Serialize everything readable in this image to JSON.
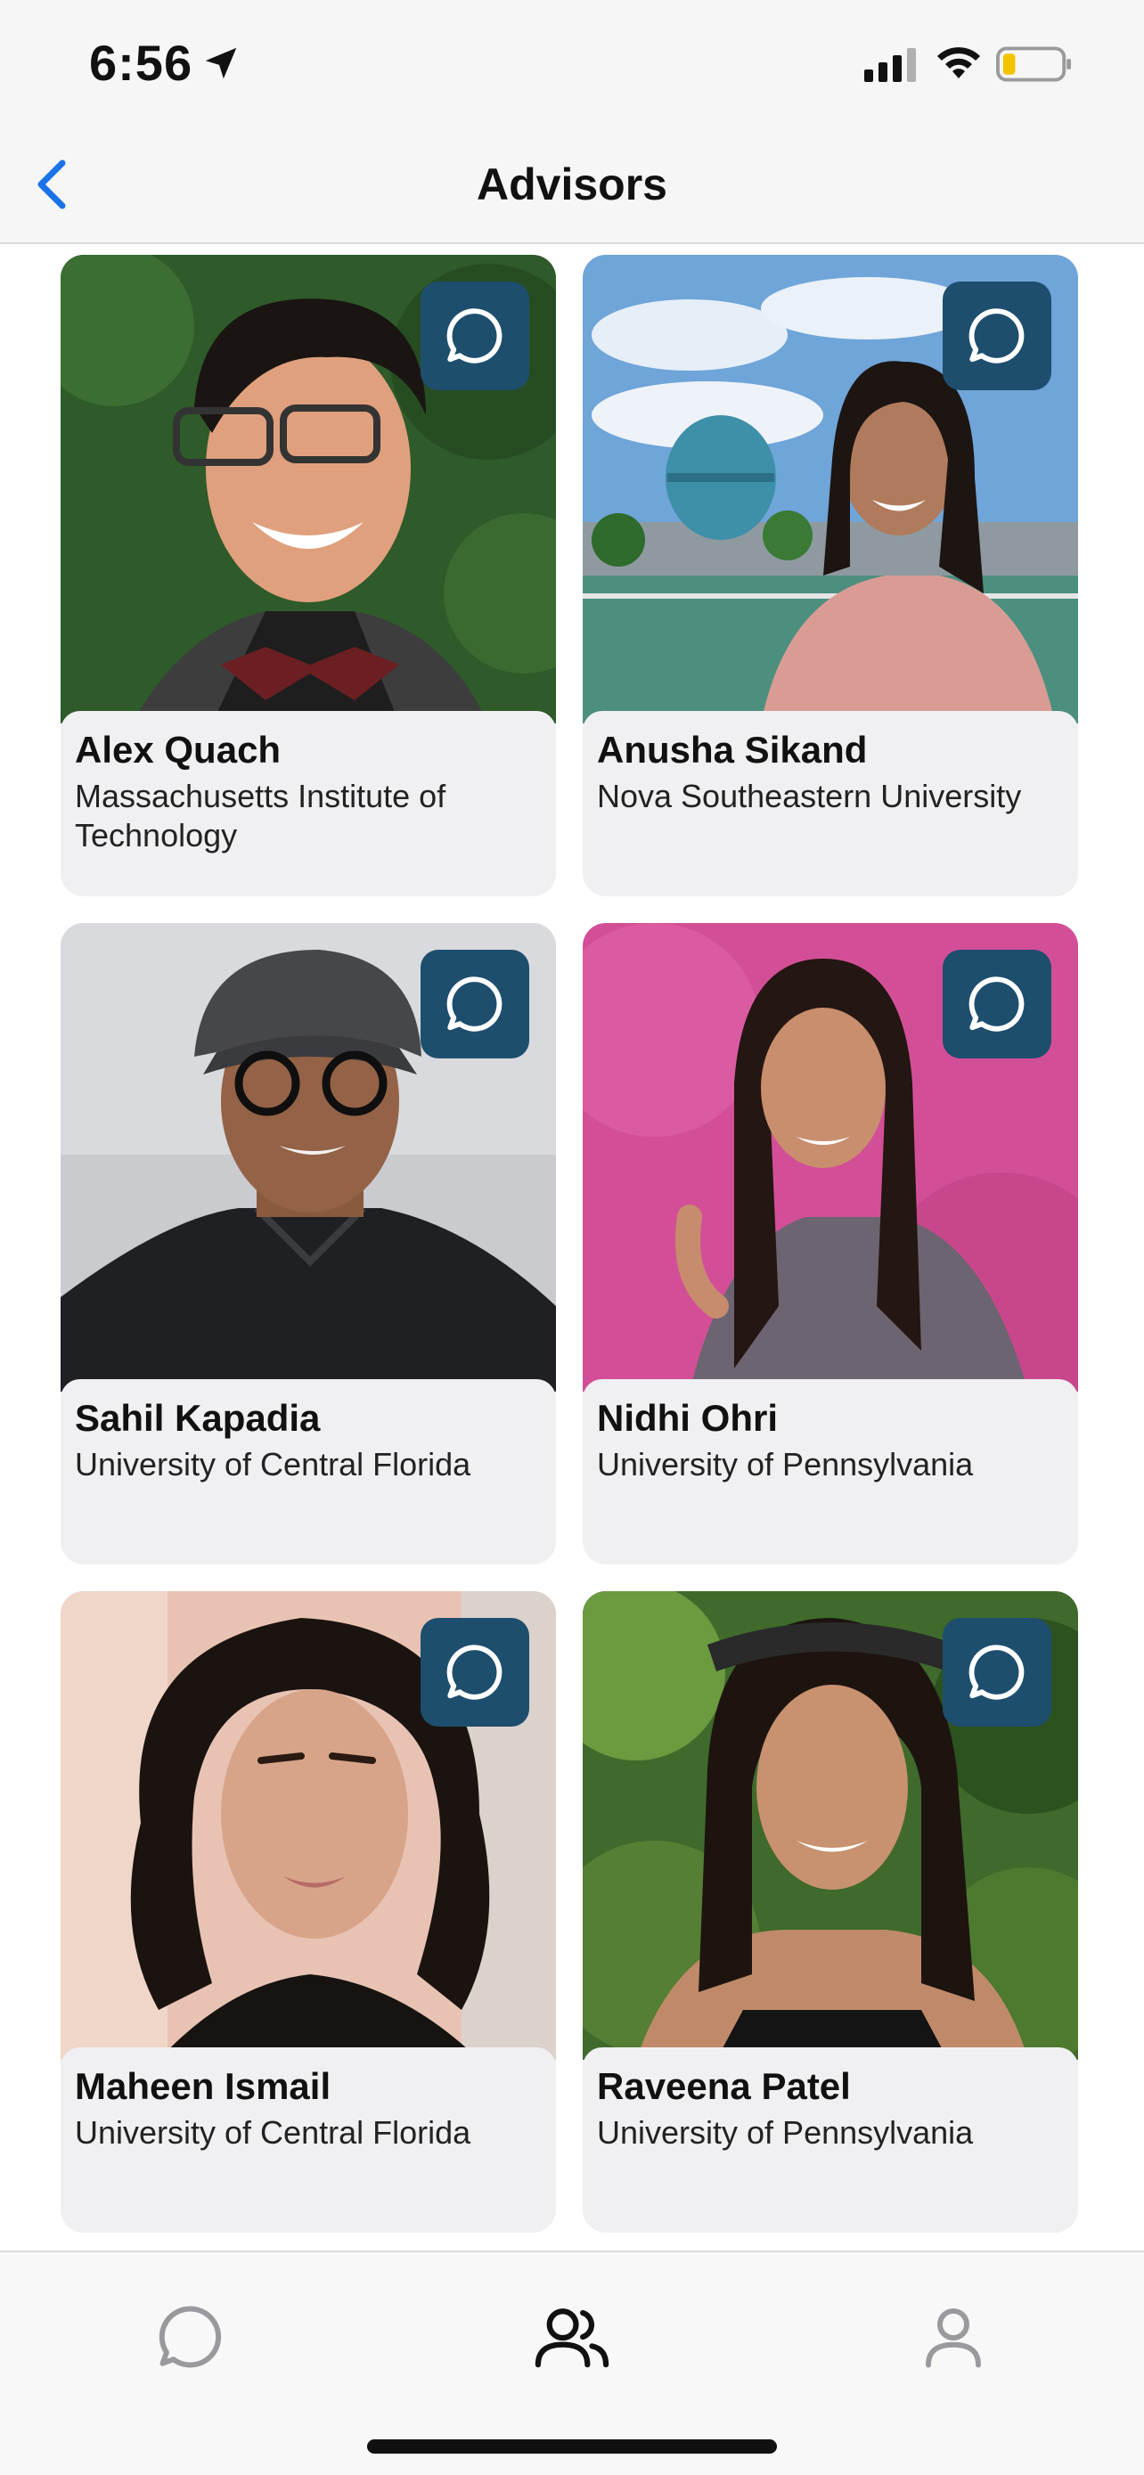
{
  "status_bar": {
    "time": "6:56"
  },
  "nav": {
    "title": "Advisors"
  },
  "advisors": [
    {
      "name": "Alex Quach",
      "school": "Massachusetts Institute of Technology"
    },
    {
      "name": "Anusha Sikand",
      "school": "Nova Southeastern University"
    },
    {
      "name": "Sahil Kapadia",
      "school": "University of Central Florida"
    },
    {
      "name": "Nidhi Ohri",
      "school": "University of Pennsylvania"
    },
    {
      "name": "Maheen Ismail",
      "school": "University of Central Florida"
    },
    {
      "name": "Raveena Patel",
      "school": "University of Pennsylvania"
    }
  ],
  "tabs": [
    {
      "icon": "chat-icon",
      "active": false
    },
    {
      "icon": "people-icon",
      "active": true
    },
    {
      "icon": "profile-icon",
      "active": false
    }
  ],
  "colors": {
    "accent": "#1e4e6e",
    "back": "#1a73e8",
    "card_bg": "#f0f0f3"
  }
}
